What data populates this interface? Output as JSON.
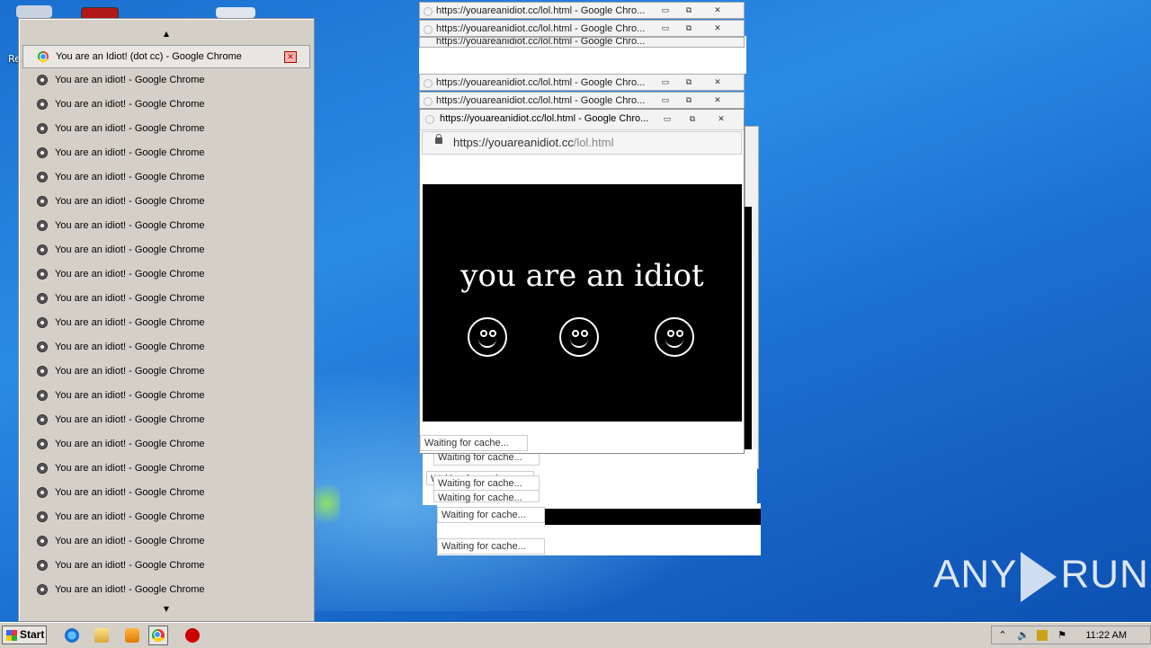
{
  "switcher": {
    "items": [
      {
        "title": "You are an Idiot! (dot cc) - Google Chrome",
        "icon": "chrome-icon",
        "active": true
      },
      {
        "title": "You are an idiot! - Google Chrome",
        "icon": "globe-icon"
      },
      {
        "title": "You are an idiot! - Google Chrome",
        "icon": "globe-icon"
      },
      {
        "title": "You are an idiot! - Google Chrome",
        "icon": "globe-icon"
      },
      {
        "title": "You are an idiot! - Google Chrome",
        "icon": "globe-icon"
      },
      {
        "title": "You are an idiot! - Google Chrome",
        "icon": "globe-icon"
      },
      {
        "title": "You are an idiot! - Google Chrome",
        "icon": "globe-icon"
      },
      {
        "title": "You are an idiot! - Google Chrome",
        "icon": "globe-icon"
      },
      {
        "title": "You are an idiot! - Google Chrome",
        "icon": "globe-icon"
      },
      {
        "title": "You are an idiot! - Google Chrome",
        "icon": "globe-icon"
      },
      {
        "title": "You are an idiot! - Google Chrome",
        "icon": "globe-icon"
      },
      {
        "title": "You are an idiot! - Google Chrome",
        "icon": "globe-icon"
      },
      {
        "title": "You are an idiot! - Google Chrome",
        "icon": "globe-icon"
      },
      {
        "title": "You are an idiot! - Google Chrome",
        "icon": "globe-icon"
      },
      {
        "title": "You are an idiot! - Google Chrome",
        "icon": "globe-icon"
      },
      {
        "title": "You are an idiot! - Google Chrome",
        "icon": "globe-icon"
      },
      {
        "title": "You are an idiot! - Google Chrome",
        "icon": "globe-icon"
      },
      {
        "title": "You are an idiot! - Google Chrome",
        "icon": "globe-icon"
      },
      {
        "title": "You are an idiot! - Google Chrome",
        "icon": "globe-icon"
      },
      {
        "title": "You are an idiot! - Google Chrome",
        "icon": "globe-icon"
      },
      {
        "title": "You are an idiot! - Google Chrome",
        "icon": "globe-icon"
      },
      {
        "title": "You are an idiot! - Google Chrome",
        "icon": "globe-icon"
      },
      {
        "title": "You are an idiot! - Google Chrome",
        "icon": "globe-icon"
      }
    ],
    "scroll_up": "▲",
    "scroll_down": "▼",
    "close_glyph": "✕"
  },
  "windows": {
    "title": "https://youareanidiot.cc/lol.html - Google Chro...",
    "main_title": "https://youareanidiot.cc/lol.html - Google Chro...",
    "min": "▭",
    "max": "⧉",
    "close": "✕",
    "url_host": "https://youareanidiot.cc",
    "url_path": "/lol.html",
    "page_text": "you are an idiot",
    "status": "Waiting for cache..."
  },
  "desktop": {
    "label_re": "Re"
  },
  "watermark": {
    "left": "ANY",
    "right": "RUN"
  },
  "taskbar": {
    "start_label": "Start",
    "clock": "11:22 AM",
    "icons": [
      "ie-icon",
      "explorer-icon",
      "media-player-icon",
      "chrome-icon",
      "stop-icon"
    ],
    "tray_icons": [
      "chevron-up-icon",
      "volume-icon",
      "network-icon",
      "flag-icon"
    ]
  }
}
